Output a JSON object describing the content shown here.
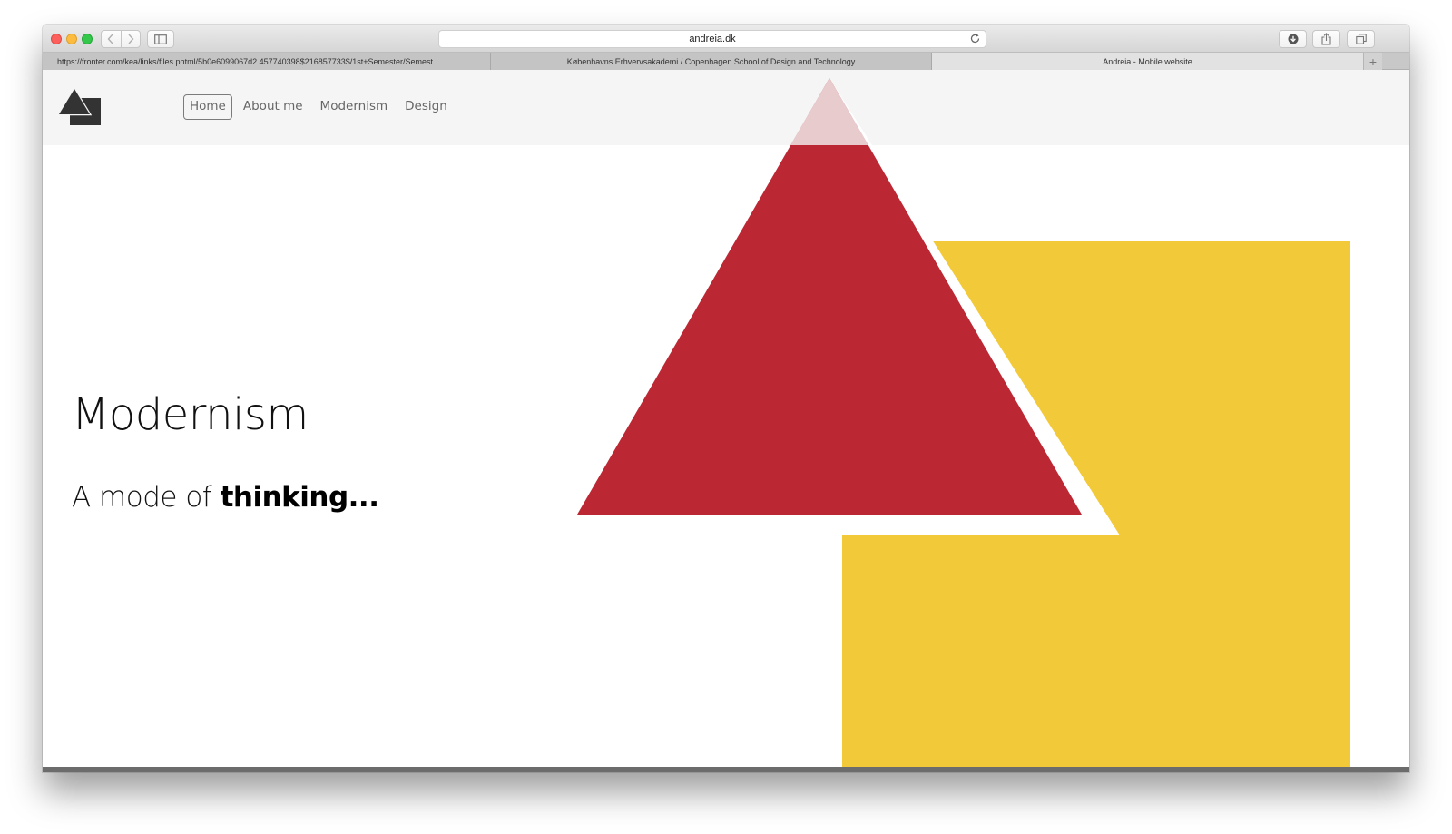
{
  "browser": {
    "url": "andreia.dk",
    "tabs": [
      {
        "title": "https://fronter.com/kea/links/files.phtml/5b0e6099067d2.457740398$216857733$/1st+Semester/Semest..."
      },
      {
        "title": "Københavns Erhvervsakademi / Copenhagen School of Design and Technology"
      },
      {
        "title": "Andreia - Mobile website"
      }
    ],
    "new_tab_label": "+"
  },
  "site": {
    "nav": [
      {
        "label": "Home",
        "active": true
      },
      {
        "label": "About me"
      },
      {
        "label": "Modernism"
      },
      {
        "label": "Design"
      }
    ],
    "hero": {
      "title": "Modernism",
      "subtitle_light": "A mode of ",
      "subtitle_bold": "thinking..."
    }
  },
  "colors": {
    "triangle_red": "#bb2833",
    "triangle_tip_pink": "#e8cbcd",
    "square_yellow": "#f2c938",
    "logo_dark": "#333333",
    "header_bg": "#f5f5f5"
  },
  "icons": {
    "back": "chevron-left-icon",
    "forward": "chevron-right-icon",
    "sidebar": "sidebar-icon",
    "reload": "reload-icon",
    "download": "download-icon",
    "share": "share-icon",
    "tabs": "tabs-overview-icon",
    "logo": "triangle-square-logo-icon"
  }
}
